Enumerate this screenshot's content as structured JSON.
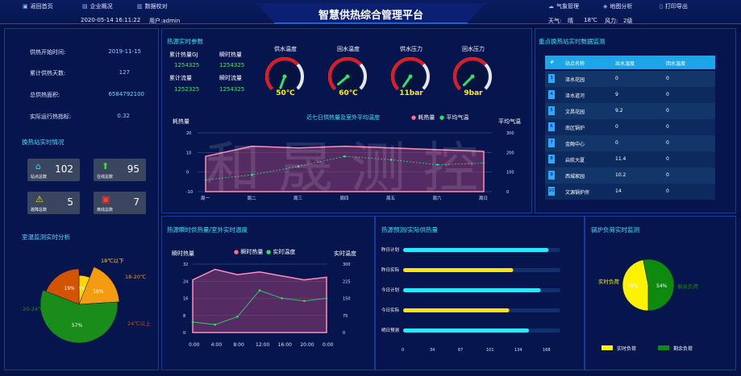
{
  "header": {
    "title": "智慧供热综合管理平台",
    "nav_left": [
      "返回首页",
      "企业概况",
      "数据校对"
    ],
    "nav_right": [
      "气象管理",
      "地图分析",
      "打印导出"
    ],
    "datetime": "2020-05-14 16:11:22",
    "user": "用户:admin",
    "weather_label": "天气:",
    "weather_value": "晴",
    "temp": "18℃",
    "wind_label": "风力:",
    "wind_value": "2级"
  },
  "heating_info": {
    "items": [
      {
        "k": "供热开始时间:",
        "v": "2019-11-15"
      },
      {
        "k": "累计供热天数:",
        "v": "127"
      },
      {
        "k": "总供热面积:",
        "v": "6584792100"
      },
      {
        "k": "实际运行热指标:",
        "v": "0.32"
      }
    ]
  },
  "stations": {
    "title": "换热站实时情况",
    "items": [
      {
        "label": "站点总数",
        "value": "102",
        "color": "#40c8ff",
        "icon": "home-icon"
      },
      {
        "label": "在线总数",
        "value": "95",
        "color": "#38e038",
        "icon": "up-arrow-icon"
      },
      {
        "label": "故障总数",
        "value": "5",
        "color": "#ffe000",
        "icon": "warning-icon"
      },
      {
        "label": "离线总数",
        "value": "7",
        "color": "#ff3b3b",
        "icon": "offline-icon"
      }
    ]
  },
  "temp_analysis": {
    "title": "室温监测实时分析",
    "labels": [
      "18℃以下",
      "18-20℃",
      "20-24℃",
      "24℃以上"
    ],
    "values": [
      6,
      18,
      57,
      19
    ],
    "colors": [
      "#ffd600",
      "#f39c12",
      "#1a8c1a",
      "#d35400"
    ]
  },
  "source": {
    "title": "热源实时参数",
    "cum_heat_label": "累计热量GJ",
    "cum_heat_value": "1254325",
    "inst_heat_label": "瞬时热量",
    "inst_heat_value": "1254325",
    "cum_flow_label": "累计流量",
    "cum_flow_value": "1252325",
    "inst_flow_label": "瞬时流量",
    "inst_flow_value": "1254325"
  },
  "gauges": [
    {
      "title": "供水温度",
      "value": "50℃"
    },
    {
      "title": "回水温度",
      "value": "60℃"
    },
    {
      "title": "供水压力",
      "value": "11bar"
    },
    {
      "title": "回水压力",
      "value": "9bar"
    }
  ],
  "week_chart": {
    "title": "近七日供热量及室外平均温度",
    "legend": [
      "耗热量",
      "平均气温"
    ],
    "ylabel_left": "耗热量",
    "ylabel_right": "平均气温",
    "categories": [
      "周一",
      "周二",
      "周三",
      "周四",
      "周五",
      "周六",
      "周日"
    ]
  },
  "day_chart": {
    "title": "热源瞬时供热量/室外实时温度",
    "legend": [
      "瞬时热量",
      "实时温度"
    ],
    "ylabel_left": "瞬时热量",
    "ylabel_right": "实时温度",
    "categories": [
      "0:00",
      "4:00",
      "8:00",
      "12:00",
      "16:00",
      "20:00",
      "0:00"
    ]
  },
  "forecast": {
    "title": "热源预测/实际供热量",
    "rows": [
      {
        "label": "昨日计划",
        "value": 185,
        "color": "#2de6ff"
      },
      {
        "label": "昨日实际",
        "value": 140,
        "color": "#ffe600"
      },
      {
        "label": "今日计划",
        "value": 175,
        "color": "#2de6ff"
      },
      {
        "label": "今日实际",
        "value": 135,
        "color": "#ffe600"
      },
      {
        "label": "明日预测",
        "value": 160,
        "color": "#2de6ff"
      }
    ],
    "ticks": [
      "0",
      "34",
      "67",
      "101",
      "134",
      "168"
    ]
  },
  "load": {
    "title": "锅炉负荷实时监测",
    "labels": [
      "实时负荷",
      "剩余负荷"
    ],
    "values": [
      46,
      54
    ],
    "colors": [
      "#fff200",
      "#0e8a0e"
    ]
  },
  "table": {
    "title": "重点换热站实时数据监测",
    "headers": [
      "#",
      "站点名称",
      "出水温度",
      "回水温度"
    ],
    "rows": [
      [
        "3",
        "泽水花园",
        "0",
        "0"
      ],
      [
        "4",
        "泽水道河",
        "9",
        "0"
      ],
      [
        "5",
        "文昌花园",
        "9.2",
        "0"
      ],
      [
        "6",
        "南区锅炉",
        "0",
        "0"
      ],
      [
        "7",
        "金融中心",
        "0",
        "0"
      ],
      [
        "8",
        "启航大厦",
        "11.4",
        "0"
      ],
      [
        "9",
        "西城家园",
        "10.2",
        "0"
      ],
      [
        "10",
        "文源锅炉房",
        "14",
        "0"
      ]
    ]
  },
  "week_values": {
    "heat": [
      6,
      12,
      11,
      12,
      11,
      10,
      9
    ],
    "temp": [
      -8,
      -5,
      0,
      6,
      4,
      1,
      2
    ]
  },
  "day_values": {
    "heat": [
      20,
      28,
      24,
      26,
      23,
      20,
      22
    ],
    "temp": [
      -12,
      -14,
      -8,
      12,
      6,
      4,
      6
    ]
  }
}
